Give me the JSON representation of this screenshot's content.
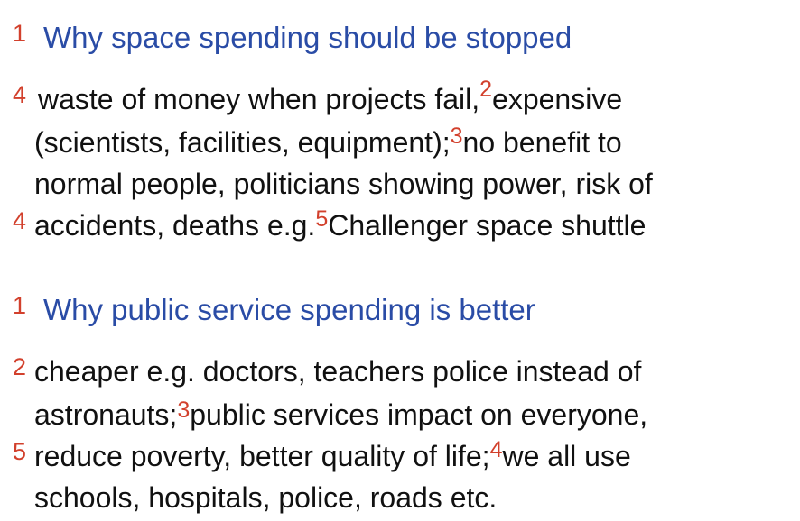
{
  "colors": {
    "heading": "#2a4ca6",
    "marker": "#d2402c",
    "body_text": "#111111"
  },
  "section1": {
    "heading_number": "1",
    "heading": "Why space spending should be stopped",
    "line1_number": "4",
    "line1a": "waste of money when projects fail,",
    "line1_sup": "2",
    "line1b": "expensive",
    "line2a": "(scientists, facilities, equipment);",
    "line2_sup": "3",
    "line2b": "no benefit to",
    "line3": "normal people, politicians showing power, risk of",
    "line4_number": "4",
    "line4a": "accidents, deaths e.g.",
    "line4_sup": "5",
    "line4b": "Challenger space shuttle"
  },
  "section2": {
    "heading_number": "1",
    "heading": "Why public service spending is better",
    "line1_number": "2",
    "line1": "cheaper e.g. doctors, teachers police instead of",
    "line2a": "astronauts;",
    "line2_sup": "3",
    "line2b": "public services impact on everyone,",
    "line3_number": "5",
    "line3a": "reduce poverty, better quality of life;",
    "line3_sup": "4",
    "line3b": "we all use",
    "line4": "schools, hospitals, police, roads etc."
  }
}
